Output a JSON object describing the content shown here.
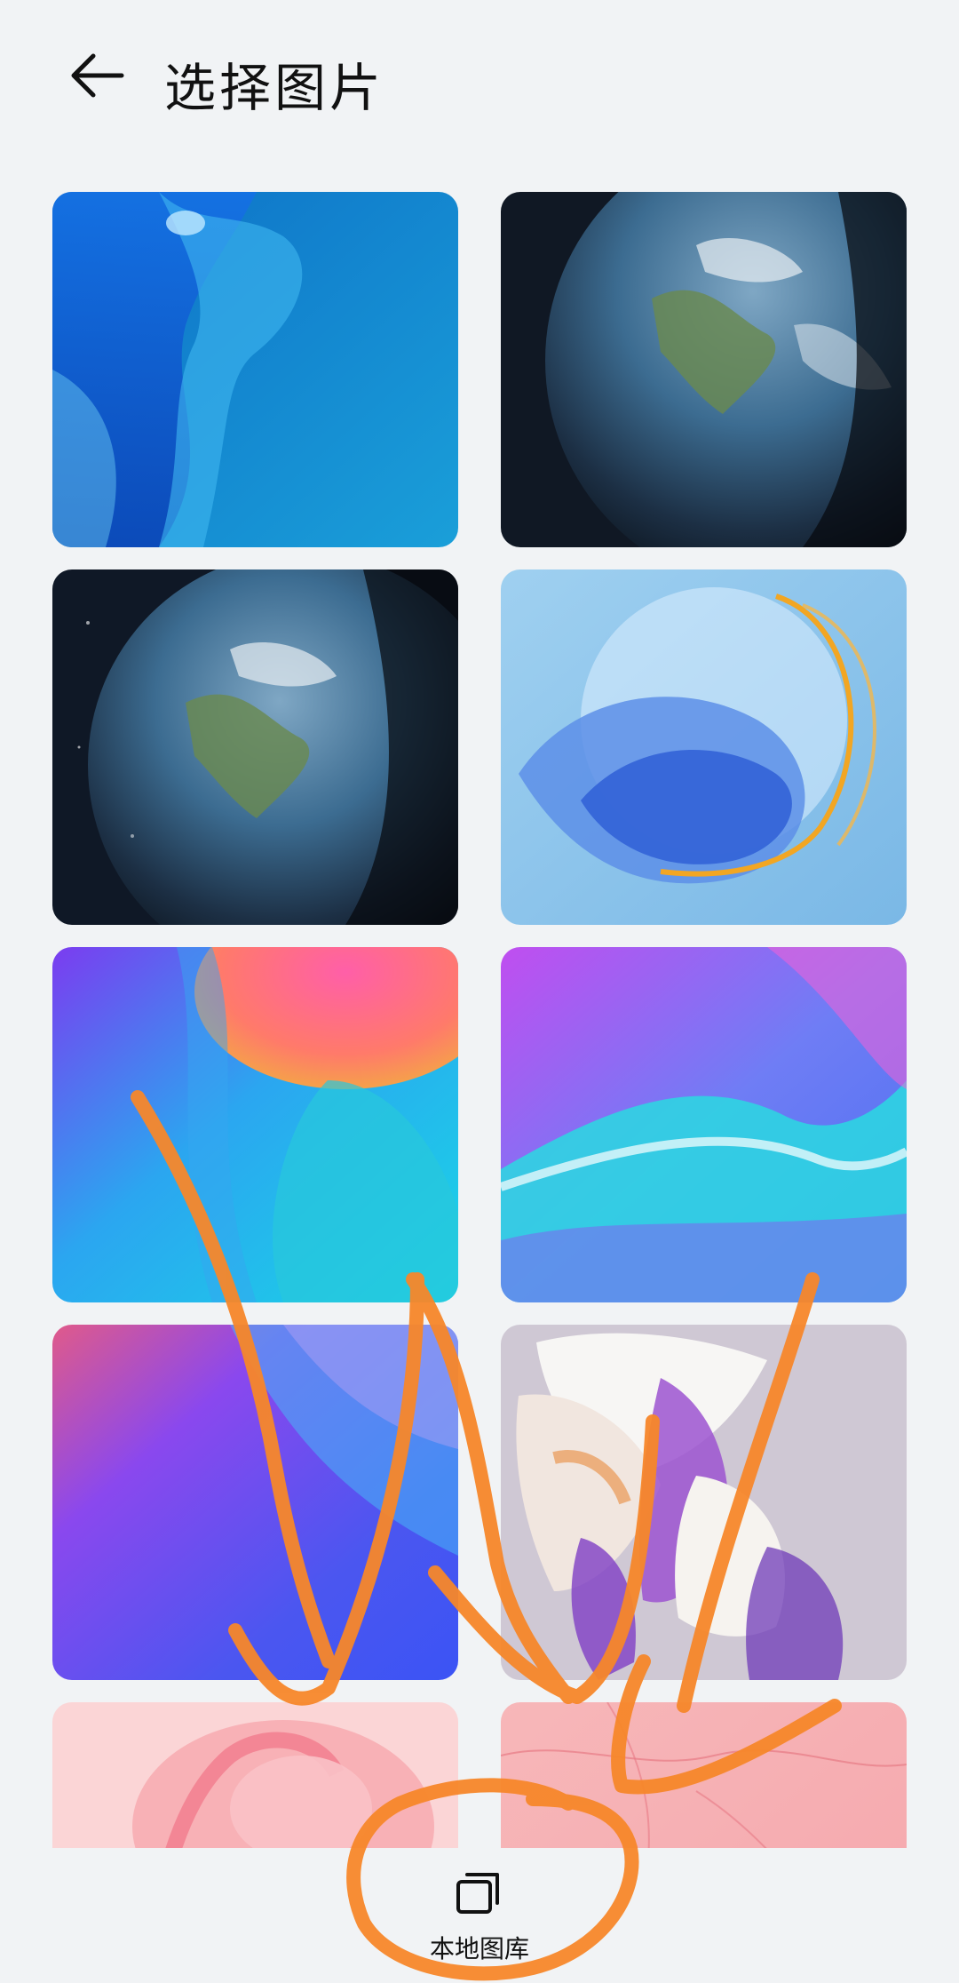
{
  "header": {
    "title": "选择图片",
    "back_icon": "arrow-left-icon"
  },
  "wallpapers": [
    {
      "name": "blue-liquid"
    },
    {
      "name": "earth-right"
    },
    {
      "name": "earth-center"
    },
    {
      "name": "blue-swirl"
    },
    {
      "name": "pink-cyan-gradient"
    },
    {
      "name": "purple-cyan-wave"
    },
    {
      "name": "purple-blue-gradient"
    },
    {
      "name": "petal-flower"
    },
    {
      "name": "pink-flamingo"
    },
    {
      "name": "pink-marble"
    }
  ],
  "bottom_bar": {
    "gallery_label": "本地图库",
    "gallery_icon": "gallery-icon"
  },
  "colors": {
    "background": "#f1f3f5",
    "annotation": "#f7872a"
  }
}
